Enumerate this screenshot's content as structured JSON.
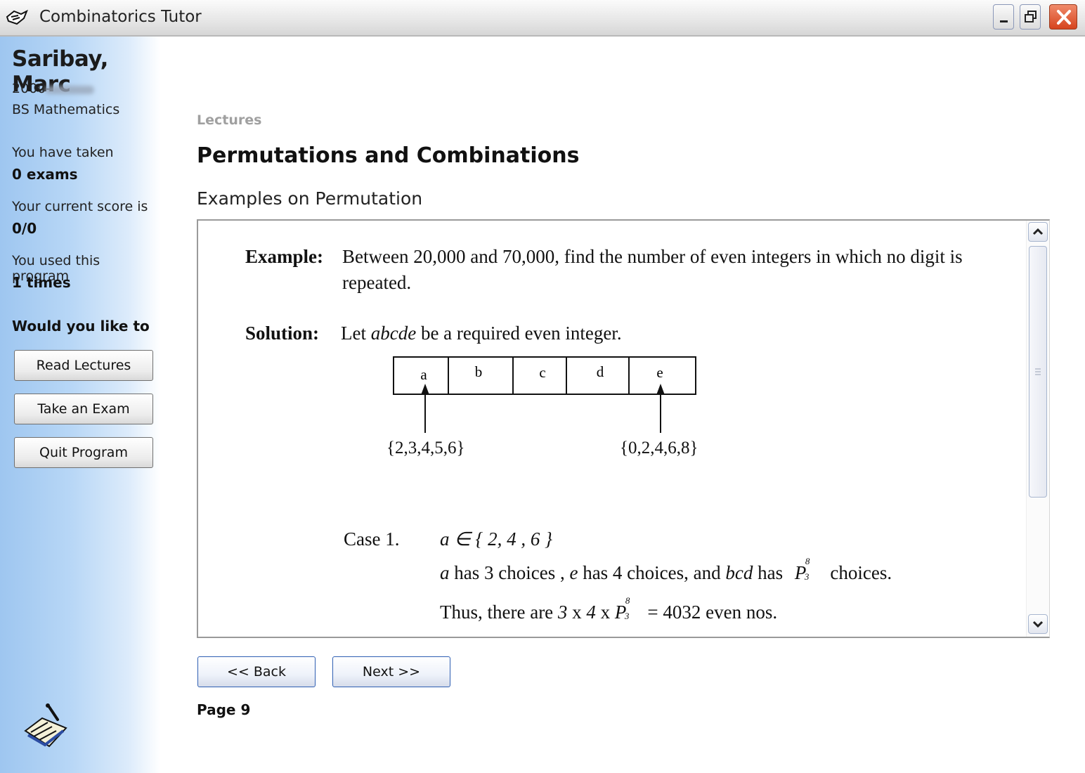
{
  "window": {
    "title": "Combinatorics Tutor"
  },
  "sidebar": {
    "name": "Saribay, Marc",
    "student_id": "2000-",
    "course": "BS Mathematics",
    "exams_label": "You have taken",
    "exams_value": "0 exams",
    "score_label": "Your current score is",
    "score_value": "0/0",
    "usage_label": "You used this program",
    "usage_value": "1 times",
    "prompt": "Would you like to",
    "buttons": {
      "read": "Read Lectures",
      "exam": "Take an Exam",
      "quit": "Quit Program"
    }
  },
  "main": {
    "breadcrumb": "Lectures",
    "title": "Permutations and Combinations",
    "subtitle": "Examples on Permutation"
  },
  "lecture": {
    "example_label": "Example:",
    "example_text_1": "Between 20,000 and 70,000, find the number of even integers in which no digit is",
    "example_text_2": "repeated.",
    "solution_label": "Solution:",
    "solution_pre": "Let ",
    "solution_var": "abcde",
    "solution_post": " be a required even integer.",
    "cells": [
      "a",
      "b",
      "c",
      "d",
      "e"
    ],
    "set_a": "{2,3,4,5,6}",
    "set_e": "{0,2,4,6,8}",
    "case_label": "Case 1.",
    "case_condition": "a ∈ { 2, 4 , 6 }",
    "choices": {
      "a": "a",
      "a_text": " has 3 choices , ",
      "e": "e",
      "e_text": " has 4 choices, and ",
      "bcd": "bcd",
      "bcd_text": " has ",
      "perm_base": "P",
      "perm_sup": "8",
      "perm_sub": "3",
      "tail": "choices."
    },
    "thus": {
      "pre": "Thus, there are ",
      "n3": "3",
      "x1": " x ",
      "n4": "4",
      "x2": " x ",
      "perm_base": "P",
      "perm_sup": "8",
      "perm_sub": "3",
      "result": "= 4032 even nos."
    }
  },
  "nav": {
    "back": "<< Back",
    "next": "Next >>",
    "page": "Page 9"
  }
}
